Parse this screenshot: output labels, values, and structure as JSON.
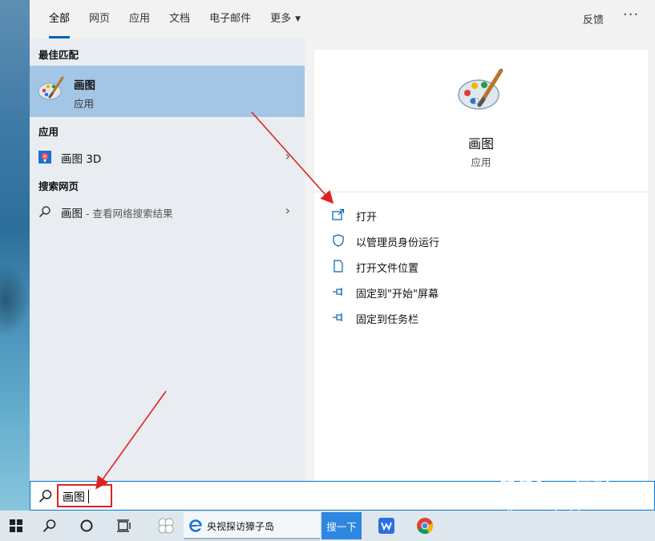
{
  "tabs": [
    {
      "label": "全部",
      "active": true
    },
    {
      "label": "网页"
    },
    {
      "label": "应用"
    },
    {
      "label": "文档"
    },
    {
      "label": "电子邮件"
    },
    {
      "label": "更多"
    }
  ],
  "header": {
    "feedback": "反馈",
    "more": "···"
  },
  "best_match": {
    "section": "最佳匹配",
    "title": "画图",
    "subtitle": "应用"
  },
  "apps": {
    "section": "应用",
    "item": "画图 3D"
  },
  "web": {
    "section": "搜索网页",
    "item": "画图",
    "hint": " - 查看网络搜索结果"
  },
  "detail": {
    "title": "画图",
    "subtitle": "应用",
    "actions": [
      "打开",
      "以管理员身份运行",
      "打开文件位置",
      "固定到\"开始\"屏幕",
      "固定到任务栏"
    ]
  },
  "search": {
    "value": "画图"
  },
  "taskbar": {
    "app_label": "央视探访獐子岛",
    "search_button": "搜一下"
  },
  "watermark": {
    "main": "Bai",
    "cn": "经验",
    "url": "jingyan.baidu.com"
  },
  "colors": {
    "accent": "#0078d7",
    "selected": "#a3c6e6",
    "annotation": "#e02020"
  }
}
